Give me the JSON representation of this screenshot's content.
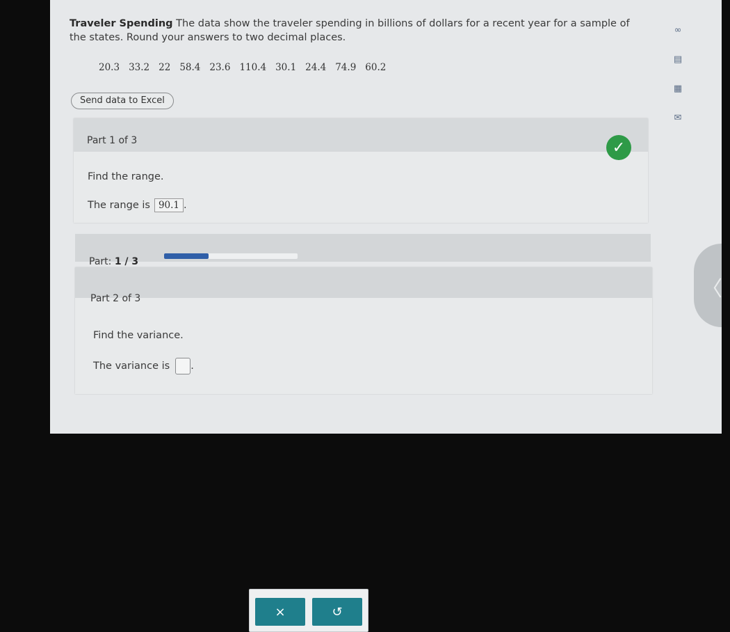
{
  "problem": {
    "title": "Traveler Spending",
    "text": "The data show the traveler spending in billions of dollars for a recent year for a sample of the states. Round your answers to two decimal places.",
    "data_values": [
      "20.3",
      "33.2",
      "22",
      "58.4",
      "23.6",
      "110.4",
      "30.1",
      "24.4",
      "74.9",
      "60.2"
    ]
  },
  "excel_button_label": "Send data to Excel",
  "part1": {
    "header": "Part 1 of 3",
    "question": "Find the range.",
    "answer_prefix": "The range is",
    "answer_value": "90.1",
    "answer_suffix": ".",
    "status": "correct",
    "status_color": "#2e9a47"
  },
  "progress": {
    "label_prefix": "Part:",
    "label_value": "1 / 3",
    "fraction": 0.333,
    "fill_color": "#2f5fa8"
  },
  "part2": {
    "header": "Part 2 of 3",
    "question": "Find the variance.",
    "answer_prefix": "The variance is",
    "answer_suffix": "."
  },
  "tools": {
    "clear_symbol": "×",
    "undo_symbol": "↺",
    "button_color": "#1f7f8c"
  },
  "side_icons": [
    "infinity-icon",
    "book-icon",
    "calculator-icon",
    "mail-icon"
  ],
  "collapse_tab_symbol": "〈"
}
